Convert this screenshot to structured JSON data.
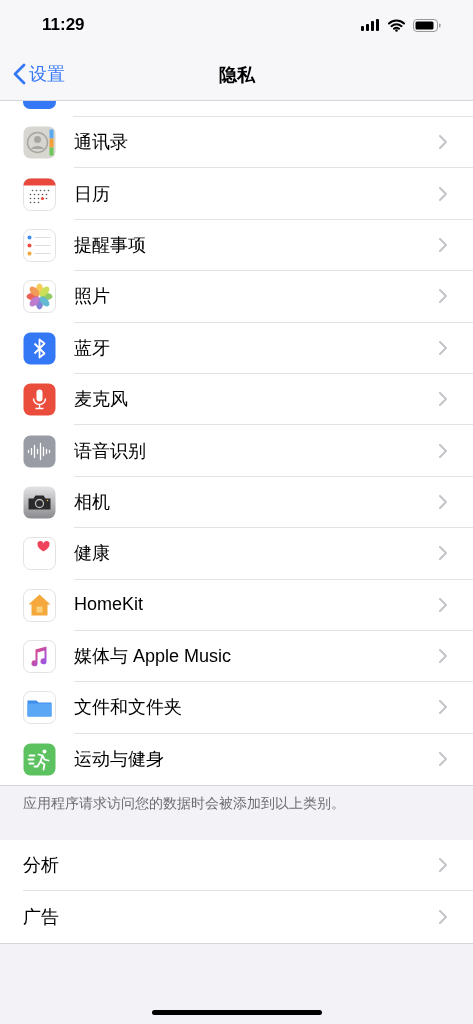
{
  "status_bar": {
    "time": "11:29"
  },
  "nav_bar": {
    "back": "设置",
    "title": "隐私"
  },
  "groups": [
    {
      "items": [
        {
          "kind": "app",
          "label": "通讯录"
        },
        {
          "kind": "app",
          "label": "日历"
        },
        {
          "kind": "app",
          "label": "提醒事项"
        },
        {
          "kind": "app",
          "label": "照片"
        },
        {
          "kind": "app",
          "label": "蓝牙"
        },
        {
          "kind": "app",
          "label": "麦克风"
        },
        {
          "kind": "app",
          "label": "语音识别"
        },
        {
          "kind": "app",
          "label": "相机"
        },
        {
          "kind": "app",
          "label": "健康"
        },
        {
          "kind": "app",
          "label": "HomeKit"
        },
        {
          "kind": "app",
          "label": "媒体与 Apple Music"
        },
        {
          "kind": "app",
          "label": "文件和文件夹"
        },
        {
          "kind": "app",
          "label": "运动与健身"
        }
      ],
      "footer": "应用程序请求访问您的数据时会被添加到以上类别。"
    },
    {
      "items": [
        {
          "kind": "plain",
          "label": "分析"
        },
        {
          "kind": "plain",
          "label": "广告"
        }
      ]
    }
  ]
}
